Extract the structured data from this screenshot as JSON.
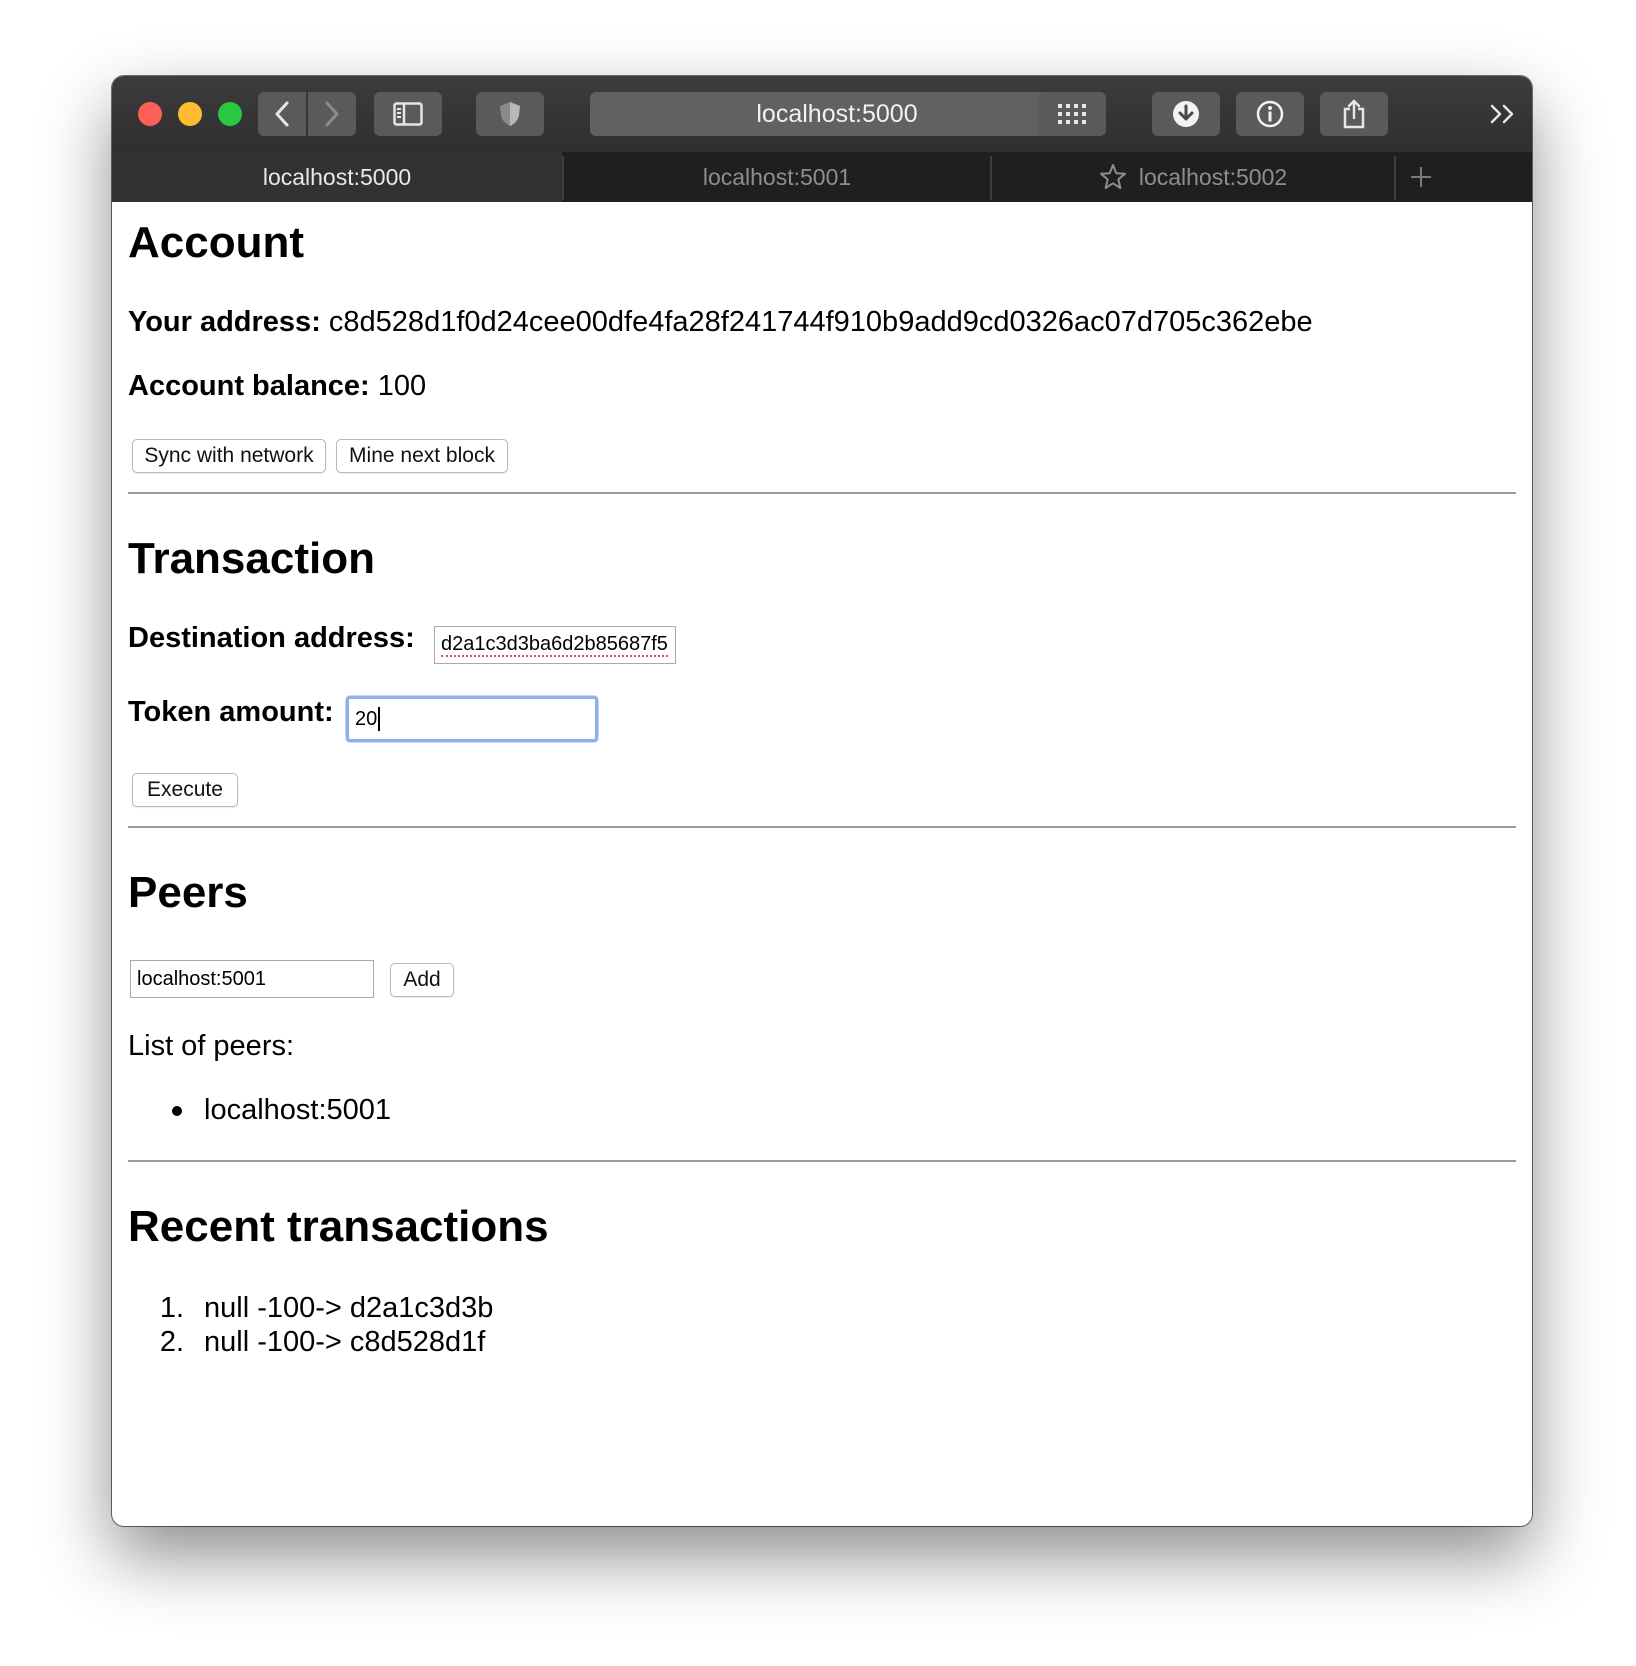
{
  "browser": {
    "url": "localhost:5000",
    "tabs": [
      {
        "label": "localhost:5000",
        "active": true
      },
      {
        "label": "localhost:5001",
        "active": false
      },
      {
        "label": "localhost:5002",
        "active": false,
        "icon": "star-icon"
      }
    ]
  },
  "account": {
    "heading": "Account",
    "address_label": "Your address:",
    "address_value": "c8d528d1f0d24cee00dfe4fa28f241744f910b9add9cd0326ac07d705c362ebe",
    "balance_label": "Account balance:",
    "balance_value": "100",
    "sync_button": "Sync with network",
    "mine_button": "Mine next block"
  },
  "transaction": {
    "heading": "Transaction",
    "destination_label": "Destination address:",
    "destination_value": "d2a1c3d3ba6d2b85687f5",
    "amount_label": "Token amount:",
    "amount_value": "20",
    "execute_button": "Execute"
  },
  "peers": {
    "heading": "Peers",
    "input_value": "localhost:5001",
    "add_button": "Add",
    "list_label": "List of peers:",
    "items": [
      "localhost:5001"
    ]
  },
  "recent_transactions": {
    "heading": "Recent transactions",
    "items": [
      {
        "num": "1.",
        "text": "null -100-> d2a1c3d3b"
      },
      {
        "num": "2.",
        "text": "null -100-> c8d528d1f"
      }
    ]
  }
}
